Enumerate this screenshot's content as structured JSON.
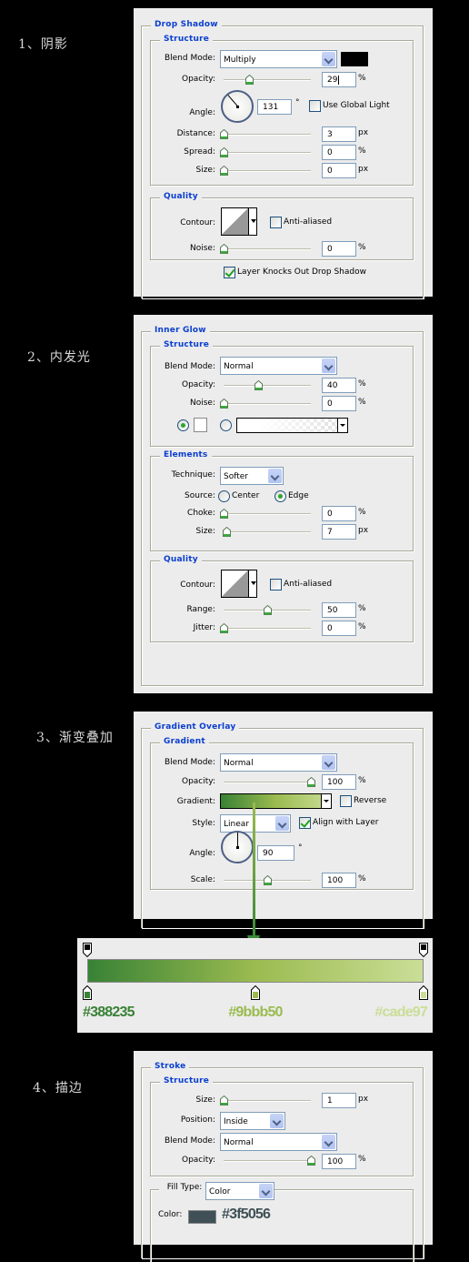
{
  "steps": [
    {
      "label": "1、阴影"
    },
    {
      "label": "2、内发光"
    },
    {
      "label": "3、渐变叠加"
    },
    {
      "label": "4、描边"
    }
  ],
  "drop_shadow": {
    "title": "Drop Shadow",
    "structure": {
      "title": "Structure",
      "blend_mode_label": "Blend Mode:",
      "blend_mode": "Multiply",
      "shadow_color": "#000000",
      "opacity_label": "Opacity:",
      "opacity": "29",
      "opacity_unit": "%",
      "opacity_fraction": 0.29,
      "angle_label": "Angle:",
      "angle": "131",
      "angle_deg": 131,
      "angle_unit": "°",
      "global_light_label": "Use Global Light",
      "global_light": false,
      "distance_label": "Distance:",
      "distance": "3",
      "distance_unit": "px",
      "distance_fraction": 0.0,
      "spread_label": "Spread:",
      "spread": "0",
      "spread_unit": "%",
      "spread_fraction": 0.0,
      "size_label": "Size:",
      "size": "0",
      "size_unit": "px",
      "size_fraction": 0.0
    },
    "quality": {
      "title": "Quality",
      "contour_label": "Contour:",
      "anti_aliased_label": "Anti-aliased",
      "anti_aliased": false,
      "noise_label": "Noise:",
      "noise": "0",
      "noise_unit": "%",
      "noise_fraction": 0.0
    },
    "knockout_label": "Layer Knocks Out Drop Shadow",
    "knockout": true
  },
  "inner_glow": {
    "title": "Inner Glow",
    "structure": {
      "title": "Structure",
      "blend_mode_label": "Blend Mode:",
      "blend_mode": "Normal",
      "opacity_label": "Opacity:",
      "opacity": "40",
      "opacity_unit": "%",
      "opacity_fraction": 0.4,
      "noise_label": "Noise:",
      "noise": "0",
      "noise_unit": "%",
      "noise_fraction": 0.0,
      "color_mode": "solid",
      "glow_color": "#ffffff"
    },
    "elements": {
      "title": "Elements",
      "technique_label": "Technique:",
      "technique": "Softer",
      "source_label": "Source:",
      "source_center_label": "Center",
      "source_edge_label": "Edge",
      "source": "edge",
      "choke_label": "Choke:",
      "choke": "0",
      "choke_unit": "%",
      "choke_fraction": 0.0,
      "size_label": "Size:",
      "size": "7",
      "size_unit": "px",
      "size_fraction": 0.03
    },
    "quality": {
      "title": "Quality",
      "contour_label": "Contour:",
      "anti_aliased_label": "Anti-aliased",
      "anti_aliased": false,
      "range_label": "Range:",
      "range": "50",
      "range_unit": "%",
      "range_fraction": 0.5,
      "jitter_label": "Jitter:",
      "jitter": "0",
      "jitter_unit": "%",
      "jitter_fraction": 0.0
    }
  },
  "gradient_overlay": {
    "title": "Gradient Overlay",
    "gradient": {
      "title": "Gradient",
      "blend_mode_label": "Blend Mode:",
      "blend_mode": "Normal",
      "opacity_label": "Opacity:",
      "opacity": "100",
      "opacity_unit": "%",
      "opacity_fraction": 1.0,
      "gradient_label": "Gradient:",
      "reverse_label": "Reverse",
      "reverse": false,
      "style_label": "Style:",
      "style": "Linear",
      "align_label": "Align with Layer",
      "align": true,
      "angle_label": "Angle:",
      "angle": "90",
      "angle_deg": 90,
      "angle_unit": "°",
      "scale_label": "Scale:",
      "scale": "100",
      "scale_unit": "%",
      "scale_fraction": 0.5
    }
  },
  "gradient_editor": {
    "stops": [
      {
        "color": "#388235",
        "label": "#388235",
        "position": 0.0
      },
      {
        "color": "#9bbb50",
        "label": "#9bbb50",
        "position": 0.5
      },
      {
        "color": "#cade97",
        "label": "#cade97",
        "position": 1.0
      }
    ],
    "opacity_stops": [
      0.0,
      1.0
    ]
  },
  "stroke": {
    "title": "Stroke",
    "structure": {
      "title": "Structure",
      "size_label": "Size:",
      "size": "1",
      "size_unit": "px",
      "size_fraction": 0.0,
      "position_label": "Position:",
      "position": "Inside",
      "blend_mode_label": "Blend Mode:",
      "blend_mode": "Normal",
      "opacity_label": "Opacity:",
      "opacity": "100",
      "opacity_unit": "%",
      "opacity_fraction": 1.0
    },
    "fill_type_label": "Fill Type:",
    "fill_type": "Color",
    "color_label": "Color:",
    "color": "#3f5056",
    "color_text": "#3f5056"
  }
}
